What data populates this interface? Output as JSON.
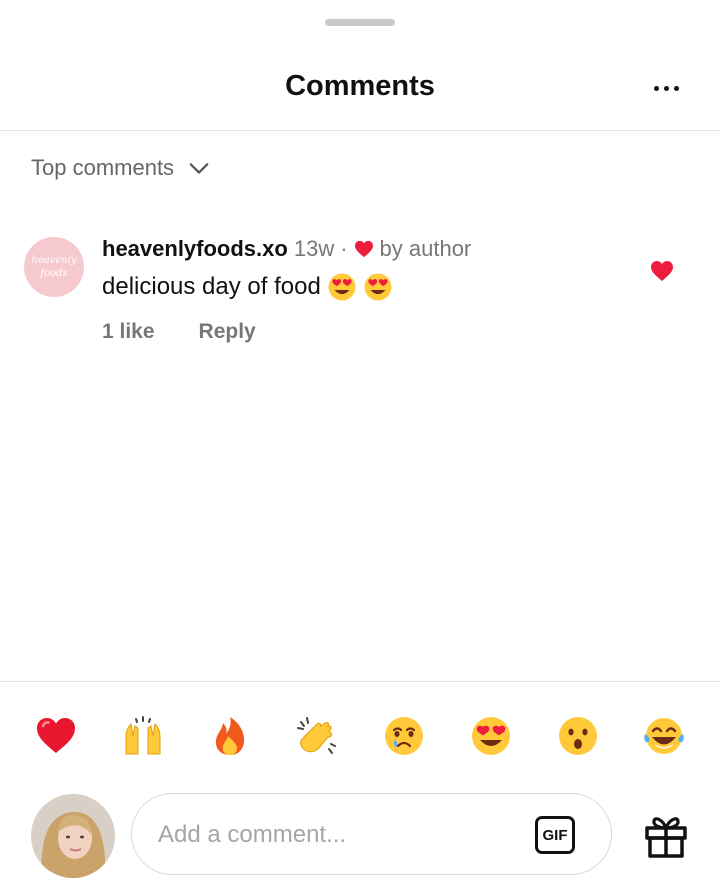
{
  "header": {
    "title": "Comments"
  },
  "sort": {
    "label": "Top comments"
  },
  "comments": [
    {
      "avatar_text": "heavenly foods",
      "username": "heavenlyfoods.xo",
      "time": "13w",
      "separator": "·",
      "author_badge": "by author",
      "text": "delicious day of food",
      "likes": "1 like",
      "reply": "Reply",
      "liked": true
    }
  ],
  "emoji_bar": [
    "red-heart",
    "raising-hands",
    "fire",
    "clapping-hands",
    "crying-face",
    "heart-eyes",
    "surprised-face",
    "tears-of-joy"
  ],
  "composer": {
    "placeholder": "Add a comment...",
    "gif_label": "GIF"
  },
  "colors": {
    "heart": "#ee1d3d",
    "divider": "#e3e3e3",
    "muted": "#777777",
    "emoji_yellow": "#ffc93a"
  }
}
